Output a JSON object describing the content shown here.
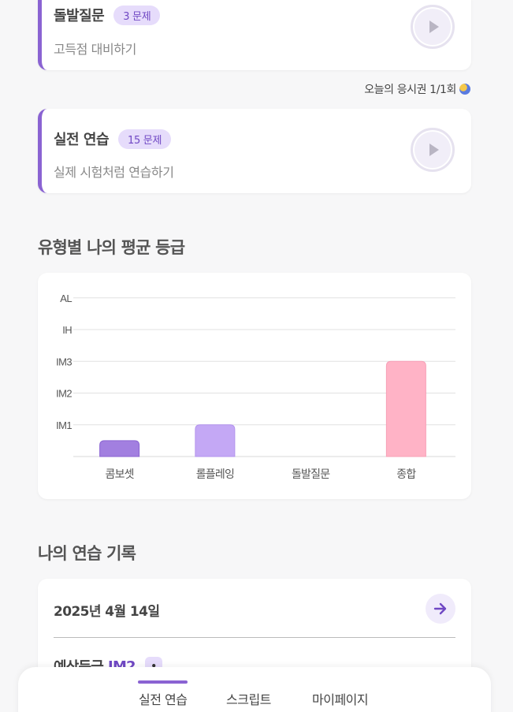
{
  "modes": [
    {
      "title": "돌발질문",
      "badge": "3 문제",
      "desc": "고득점 대비하기"
    },
    {
      "title": "실전 연습",
      "badge": "15 문제",
      "desc": "실제 시험처럼 연습하기"
    }
  ],
  "ticket": {
    "text": "오늘의 응시권 1/1회"
  },
  "grade_section": {
    "title": "유형별 나의 평균 등급"
  },
  "chart_data": {
    "type": "bar",
    "categories": [
      "콤보셋",
      "롤플레잉",
      "돌발질문",
      "종합"
    ],
    "y_levels": [
      "IM1",
      "IM2",
      "IM3",
      "IH",
      "AL"
    ],
    "values": [
      0.5,
      1,
      0,
      3
    ],
    "bar_colors": [
      "#a27fe0",
      "#c4a8f5",
      "#c4a8f5",
      "#ffb3c6"
    ],
    "ylim": [
      0,
      5
    ],
    "grid": true
  },
  "records_section": {
    "title": "나의 연습 기록"
  },
  "record": {
    "date": "2025년 4월 14일",
    "grade_label": "예상등급",
    "grade_value": "IM2"
  },
  "nav": {
    "items": [
      "실전 연습",
      "스크립트",
      "마이페이지"
    ],
    "active": "실전 연습"
  },
  "colors": {
    "accent": "#8a63d2",
    "badge_bg": "#e6dcfb",
    "pink": "#ffb3c6"
  }
}
